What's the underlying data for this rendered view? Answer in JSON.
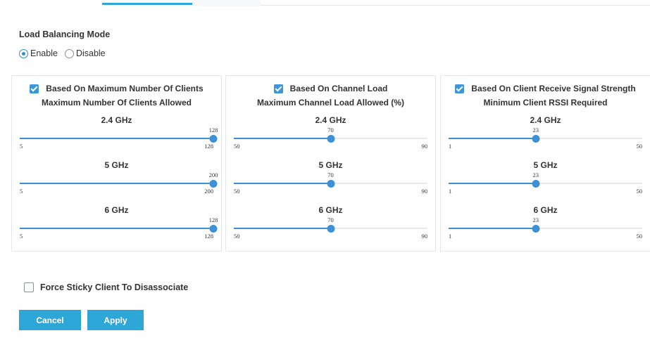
{
  "load_balancing": {
    "title": "Load Balancing Mode",
    "options": [
      {
        "label": "Enable",
        "checked": true
      },
      {
        "label": "Disable",
        "checked": false
      }
    ]
  },
  "panels": [
    {
      "title": "Based On Maximum Number Of Clients",
      "checked": true,
      "subtitle": "Maximum Number Of Clients Allowed",
      "bands": [
        {
          "label": "2.4 GHz",
          "value": "128",
          "min": "5",
          "max": "128"
        },
        {
          "label": "5 GHz",
          "value": "200",
          "min": "5",
          "max": "200"
        },
        {
          "label": "6 GHz",
          "value": "128",
          "min": "5",
          "max": "128"
        }
      ]
    },
    {
      "title": "Based On Channel Load",
      "checked": true,
      "subtitle": "Maximum Channel Load Allowed (%)",
      "bands": [
        {
          "label": "2.4 GHz",
          "value": "70",
          "min": "50",
          "max": "90"
        },
        {
          "label": "5 GHz",
          "value": "70",
          "min": "50",
          "max": "90"
        },
        {
          "label": "6 GHz",
          "value": "70",
          "min": "50",
          "max": "90"
        }
      ]
    },
    {
      "title": "Based On Client Receive Signal Strength",
      "checked": true,
      "subtitle": "Minimum Client RSSI Required",
      "bands": [
        {
          "label": "2.4 GHz",
          "value": "23",
          "min": "1",
          "max": "50"
        },
        {
          "label": "5 GHz",
          "value": "23",
          "min": "1",
          "max": "50"
        },
        {
          "label": "6 GHz",
          "value": "23",
          "min": "1",
          "max": "50"
        }
      ]
    }
  ],
  "sticky_client": {
    "label": "Force Sticky Client To Disassociate",
    "checked": false
  },
  "buttons": {
    "cancel": "Cancel",
    "apply": "Apply"
  },
  "colors": {
    "accent": "#2ea7d8",
    "slider": "#3d8fd6",
    "checkbox": "#3d96d9"
  }
}
